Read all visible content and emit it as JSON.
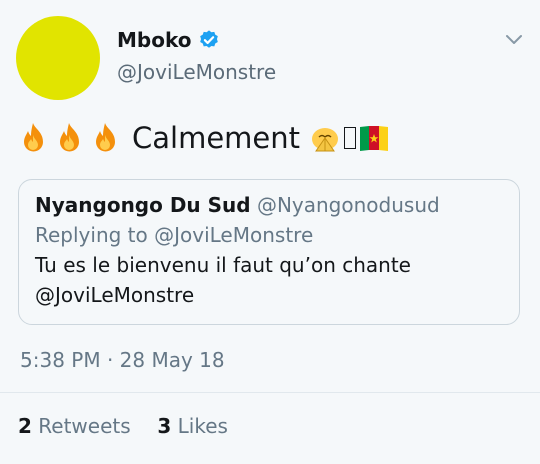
{
  "author": {
    "display_name": "Mboko",
    "handle": "@JoviLeMonstre",
    "avatar_color": "#e1e400",
    "verified_color": "#1da1f2"
  },
  "tweet": {
    "text": "Calmement",
    "emoji": [
      "fire-icon",
      "fire-icon",
      "fire-icon",
      "pray-icon",
      "missing-glyph",
      "cameroon-flag-icon"
    ]
  },
  "quoted_tweet": {
    "name": "Nyangongo Du Sud",
    "handle": "@Nyangonodusud",
    "replying_to": "Replying to @JoviLeMonstre",
    "body_line1": "Tu es le bienvenu il faut qu’on chante",
    "body_line2": "@JoviLeMonstre"
  },
  "timestamp": "5:38 PM · 28 May 18",
  "stats": {
    "retweets_count": "2",
    "retweets_label": "Retweets",
    "likes_count": "3",
    "likes_label": "Likes"
  }
}
